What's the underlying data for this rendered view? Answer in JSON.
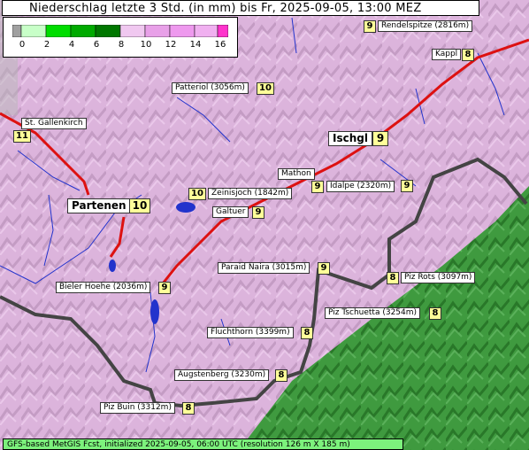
{
  "title": "Niederschlag letzte 3 Std. (in mm) bis Fr, 2025-09-05, 13:00 MEZ",
  "legend": {
    "ticks": [
      "0",
      "2",
      "4",
      "6",
      "8",
      "10",
      "12",
      "14",
      "16"
    ],
    "colors": [
      "#a0a0a0",
      "#c8ffc8",
      "#00dd00",
      "#00aa00",
      "#007700",
      "#f0c8f0",
      "#e8a0e8",
      "#ff66ff",
      "#ff33cc"
    ]
  },
  "labels": [
    {
      "name": "Rendelspitze (2816m)",
      "value": "9"
    },
    {
      "name": "Kappl",
      "value": "8"
    },
    {
      "name": "Patteriol (3056m)",
      "value": "10"
    },
    {
      "name": "St. Gallenkirch",
      "value": "11"
    },
    {
      "name": "Ischgl",
      "value": "9"
    },
    {
      "name": "Mathon",
      "value": "9"
    },
    {
      "name": "Idalpe (2320m)",
      "value": "9"
    },
    {
      "name": "Zeinisjoch (1842m)",
      "value": "10"
    },
    {
      "name": "Partenen",
      "value": "10"
    },
    {
      "name": "Galtuer",
      "value": "9"
    },
    {
      "name": "Paraid Naira (3015m)",
      "value": "9"
    },
    {
      "name": "Piz Rots (3097m)",
      "value": "8"
    },
    {
      "name": "Bieler Hoehe (2036m)",
      "value": "9"
    },
    {
      "name": "Piz Tschuetta (3254m)",
      "value": "8"
    },
    {
      "name": "Fluchthorn (3399m)",
      "value": "8"
    },
    {
      "name": "Augstenberg (3230m)",
      "value": "8"
    },
    {
      "name": "Piz Buin (3312m)",
      "value": "8"
    }
  ],
  "footer": "GFS-based MetGIS Fcst, initialized 2025-09-05, 06:00 UTC  (resolution 126 m X 185 m)"
}
